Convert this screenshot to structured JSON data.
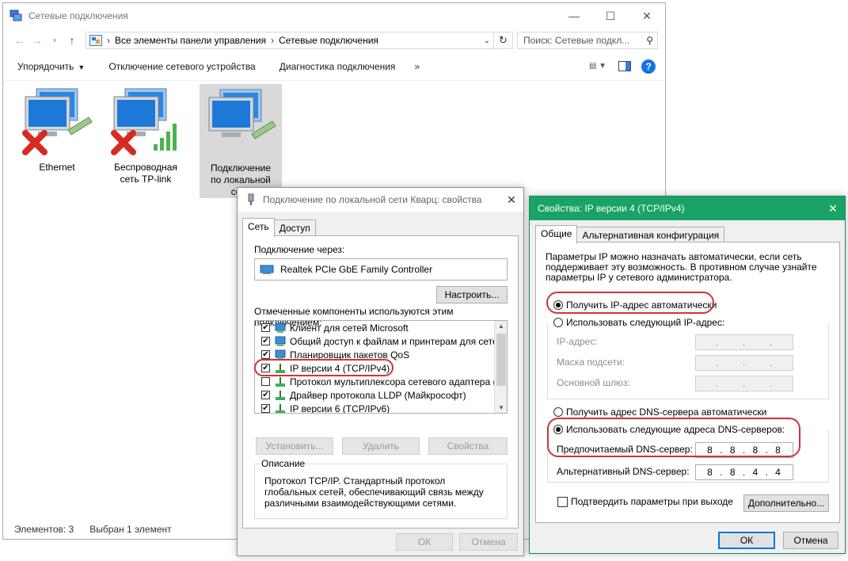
{
  "explorer": {
    "title": "Сетевые подключения",
    "breadcrumb": [
      "Все элементы панели управления",
      "Сетевые подключения"
    ],
    "search_placeholder": "Поиск: Сетевые подкл...",
    "toolbar": {
      "organize": "Упорядочить",
      "disable": "Отключение сетевого устройства",
      "diagnose": "Диагностика подключения",
      "more": "»"
    },
    "items": [
      {
        "line1": "Ethernet",
        "line2": "",
        "line3": ""
      },
      {
        "line1": "Беспроводная",
        "line2": "сеть TP-link",
        "line3": ""
      },
      {
        "line1": "Подключение",
        "line2": "по локальной",
        "line3": "сети"
      }
    ],
    "status": {
      "count": "Элементов: 3",
      "selected": "Выбран 1 элемент"
    }
  },
  "props": {
    "title": "Подключение по локальной сети Кварц: свойства",
    "tabs": [
      "Сеть",
      "Доступ"
    ],
    "connect_via_label": "Подключение через:",
    "adapter": "Realtek PCIe GbE Family Controller",
    "configure": "Настроить...",
    "components_label": "Отмеченные компоненты используются этим подключением:",
    "components": [
      {
        "label": "Клиент для сетей Microsoft",
        "checked": "✔"
      },
      {
        "label": "Общий доступ к файлам и принтерам для сетей Mi",
        "checked": "✔"
      },
      {
        "label": "Планировщик пакетов QoS",
        "checked": "✔"
      },
      {
        "label": "IP версии 4 (TCP/IPv4)",
        "checked": "✔"
      },
      {
        "label": "Протокол мультиплексора сетевого адаптера (Ма",
        "checked": ""
      },
      {
        "label": "Драйвер протокола LLDP (Майкрософт)",
        "checked": "✔"
      },
      {
        "label": "IP версии 6 (TCP/IPv6)",
        "checked": "✔"
      }
    ],
    "install": "Установить...",
    "remove": "Удалить",
    "properties": "Свойства",
    "description_title": "Описание",
    "description": "Протокол TCP/IP. Стандартный протокол глобальных сетей, обеспечивающий связь между различными взаимодействующими сетями.",
    "ok": "ОК",
    "cancel": "Отмена"
  },
  "ipv4": {
    "title": "Свойства: IP версии 4 (TCP/IPv4)",
    "tabs": [
      "Общие",
      "Альтернативная конфигурация"
    ],
    "info": "Параметры IP можно назначать автоматически, если сеть поддерживает эту возможность. В противном случае узнайте параметры IP у сетевого администратора.",
    "auto_ip": "Получить IP-адрес автоматически",
    "manual_ip": "Использовать следующий IP-адрес:",
    "ip_label": "IP-адрес:",
    "mask_label": "Маска подсети:",
    "gateway_label": "Основной шлюз:",
    "auto_dns": "Получить адрес DNS-сервера автоматически",
    "manual_dns": "Использовать следующие адреса DNS-серверов:",
    "preferred_label": "Предпочитаемый DNS-сервер:",
    "alternate_label": "Альтернативный DNS-сервер:",
    "preferred_dns": [
      "8",
      "8",
      "8",
      "8"
    ],
    "alternate_dns": [
      "8",
      "8",
      "4",
      "4"
    ],
    "validate": "Подтвердить параметры при выходе",
    "advanced": "Дополнительно...",
    "ok": "ОК",
    "cancel": "Отмена"
  },
  "colors": {
    "accent_green": "#1aa367",
    "highlight_red": "#d0343b",
    "selection": "#d9d9d9"
  }
}
